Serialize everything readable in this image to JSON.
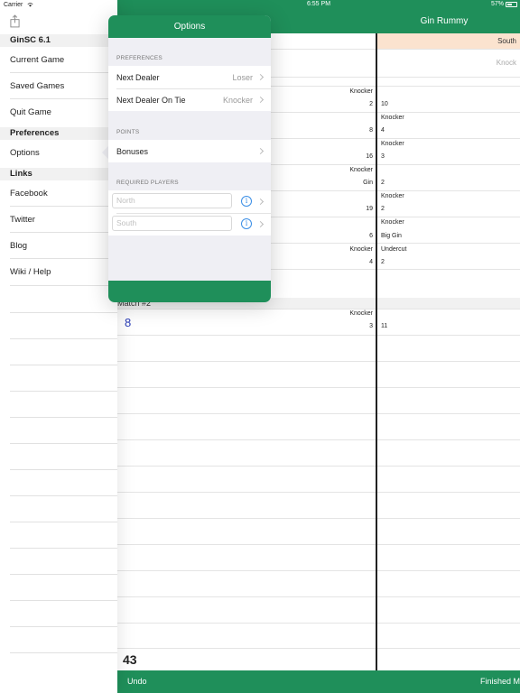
{
  "status": {
    "carrier": "Carrier",
    "time": "6:55 PM",
    "battery": "57%"
  },
  "sidebar": {
    "version": "GinSC 6.1",
    "items_top": [
      "Current Game",
      "Saved Games",
      "Quit Game"
    ],
    "preferences_header": "Preferences",
    "options_label": "Options",
    "links_header": "Links",
    "links": [
      "Facebook",
      "Twitter",
      "Blog",
      "Wiki / Help"
    ]
  },
  "main": {
    "title": "Gin Rummy",
    "south_label": "South",
    "knock_hint": "Knock",
    "rows": [
      {
        "left_label": "Knocker",
        "left_value": "2",
        "right_value": "10"
      },
      {
        "right_label": "Knocker",
        "left_value": "8",
        "right_value": "4"
      },
      {
        "right_label": "Knocker",
        "left_value": "16",
        "right_value": "3"
      },
      {
        "left_label": "Knocker",
        "left_value": "Gin",
        "right_value": "2"
      },
      {
        "right_label": "Knocker",
        "left_value": "19",
        "right_value": "2"
      },
      {
        "right_label": "Knocker",
        "left_value": "6",
        "right_value": "Big Gin"
      },
      {
        "left_label": "Knocker",
        "right_label": "Undercut",
        "left_value": "4",
        "right_value": "2"
      }
    ],
    "match_label": "Match #2",
    "match_score": "8",
    "match_row": {
      "left_label": "Knocker",
      "left_value": "3",
      "right_value": "11"
    },
    "total_left": "43",
    "undo_label": "Undo",
    "finished_label": "Finished M"
  },
  "popover": {
    "title": "Options",
    "sections": {
      "preferences": "PREFERENCES",
      "points": "POINTS",
      "required_players": "REQUIRED PLAYERS"
    },
    "next_dealer": {
      "label": "Next Dealer",
      "value": "Loser"
    },
    "next_dealer_tie": {
      "label": "Next Dealer On Tie",
      "value": "Knocker"
    },
    "bonuses": {
      "label": "Bonuses"
    },
    "players": [
      {
        "placeholder": "North"
      },
      {
        "placeholder": "South"
      }
    ]
  },
  "colors": {
    "accent": "#1f8f5a",
    "south_bg": "#fbe3cf",
    "score_blue": "#2a3db8"
  }
}
